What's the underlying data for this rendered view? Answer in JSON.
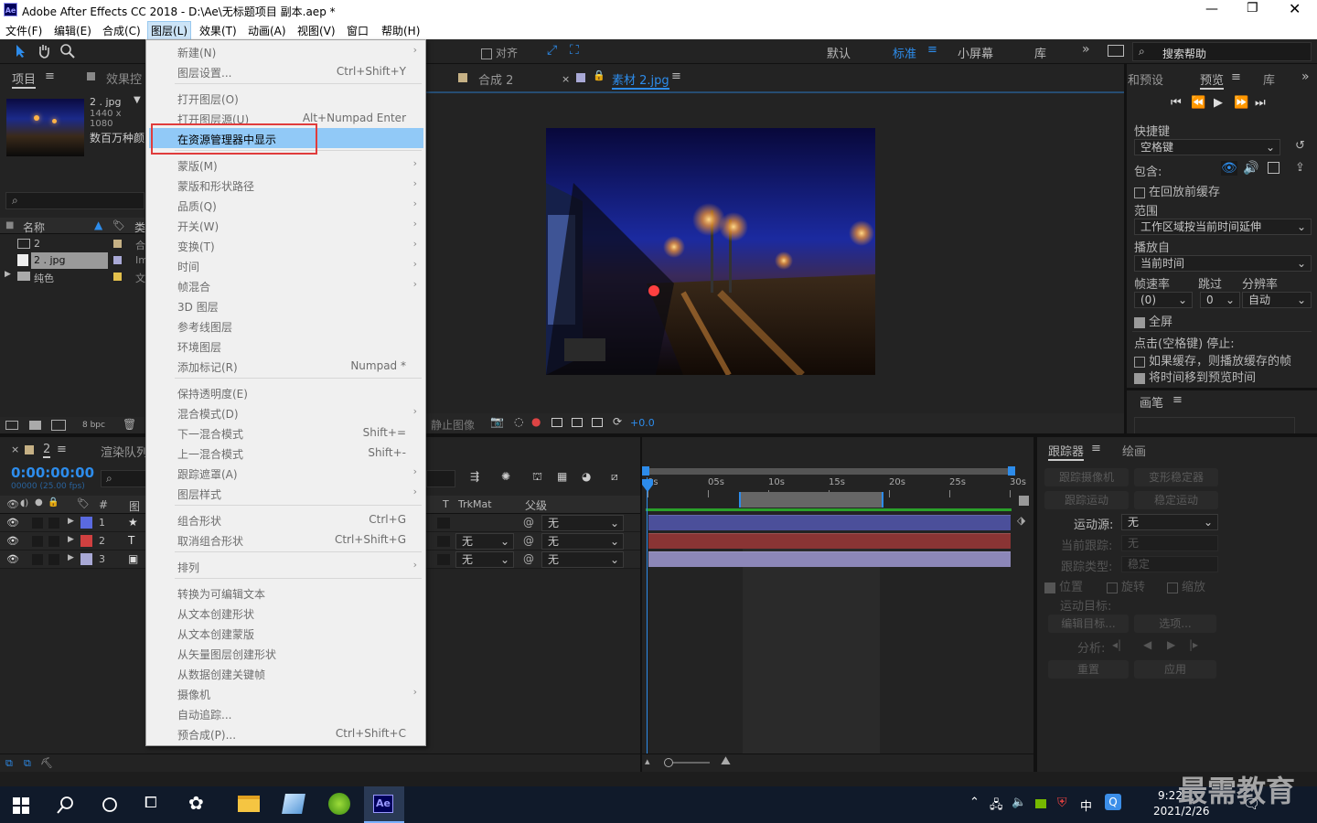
{
  "window": {
    "title": "Adobe After Effects CC 2018 - D:\\Ae\\无标题项目 副本.aep *",
    "logo": "Ae",
    "controls": [
      "minimize-icon",
      "restore-icon",
      "close-icon"
    ]
  },
  "menubar": [
    "文件(F)",
    "编辑(E)",
    "合成(C)",
    "图层(L)",
    "效果(T)",
    "动画(A)",
    "视图(V)",
    "窗口",
    "帮助(H)"
  ],
  "toolbar": {
    "snap": "对齐",
    "workspaces": [
      "默认",
      "标准",
      "小屏幕",
      "库"
    ],
    "search_placeholder": "搜索帮助"
  },
  "project": {
    "tabs": [
      "项目",
      "效果控"
    ],
    "item_name": "2 . jpg",
    "item_size": "1440 x 1080",
    "item_colors": "数百万种颜",
    "col_name": "名称",
    "col_type": "类",
    "rows": [
      {
        "name": "2",
        "tag": "合"
      },
      {
        "name": "2 . jpg",
        "tag": "Im"
      },
      {
        "name": "纯色",
        "tag": "文"
      }
    ],
    "bpc": "8 bpc"
  },
  "comp": {
    "tabs": [
      "合成 2",
      "素材 2.jpg"
    ],
    "footer_label": "静止图像",
    "offset": "+0.0"
  },
  "layer_menu": [
    {
      "label": "新建(N)",
      "submenu": true
    },
    {
      "label": "图层设置...",
      "shortcut": "Ctrl+Shift+Y"
    },
    {
      "sep": true
    },
    {
      "label": "打开图层(O)"
    },
    {
      "label": "打开图层源(U)",
      "shortcut": "Alt+Numpad Enter"
    },
    {
      "label": "在资源管理器中显示",
      "highlight": true
    },
    {
      "sep": true
    },
    {
      "label": "蒙版(M)",
      "submenu": true
    },
    {
      "label": "蒙版和形状路径",
      "submenu": true
    },
    {
      "label": "品质(Q)",
      "submenu": true
    },
    {
      "label": "开关(W)",
      "submenu": true
    },
    {
      "label": "变换(T)",
      "submenu": true
    },
    {
      "label": "时间",
      "submenu": true
    },
    {
      "label": "帧混合",
      "submenu": true
    },
    {
      "label": "3D 图层"
    },
    {
      "label": "参考线图层"
    },
    {
      "label": "环境图层"
    },
    {
      "label": "添加标记(R)",
      "shortcut": "Numpad *"
    },
    {
      "sep": true
    },
    {
      "label": "保持透明度(E)"
    },
    {
      "label": "混合模式(D)",
      "submenu": true
    },
    {
      "label": "下一混合模式",
      "shortcut": "Shift+="
    },
    {
      "label": "上一混合模式",
      "shortcut": "Shift+-"
    },
    {
      "label": "跟踪遮罩(A)",
      "submenu": true
    },
    {
      "label": "图层样式",
      "submenu": true
    },
    {
      "sep": true
    },
    {
      "label": "组合形状",
      "shortcut": "Ctrl+G"
    },
    {
      "label": "取消组合形状",
      "shortcut": "Ctrl+Shift+G"
    },
    {
      "sep": true
    },
    {
      "label": "排列",
      "submenu": true
    },
    {
      "sep": true
    },
    {
      "label": "转换为可编辑文本"
    },
    {
      "label": "从文本创建形状"
    },
    {
      "label": "从文本创建蒙版"
    },
    {
      "label": "从矢量图层创建形状"
    },
    {
      "label": "从数据创建关键帧"
    },
    {
      "label": "摄像机",
      "submenu": true
    },
    {
      "label": "自动追踪..."
    },
    {
      "label": "预合成(P)...",
      "shortcut": "Ctrl+Shift+C"
    }
  ],
  "preview": {
    "tabs": [
      "和预设",
      "预览",
      "库"
    ],
    "shortcut_label": "快捷键",
    "shortcut_value": "空格键",
    "include": "包含:",
    "cache_before": "在回放前缓存",
    "range_label": "范围",
    "range_value": "工作区域按当前时间延伸",
    "play_from_label": "播放自",
    "play_from_value": "当前时间",
    "fps_label": "帧速率",
    "skip_label": "跳过",
    "res_label": "分辨率",
    "fps_value": "(0)",
    "skip_value": "0",
    "res_value": "自动",
    "fullscreen": "全屏",
    "stop_label": "点击(空格键) 停止:",
    "if_cache": "如果缓存，则播放缓存的帧",
    "move_time": "将时间移到预览时间",
    "brush": "画笔"
  },
  "timeline": {
    "comp_tab": "2",
    "render_tab": "渲染队列",
    "timecode": "0:00:00:00",
    "fps": "00000 (25.00 fps)",
    "col_trkmat": "TrkMat",
    "col_parent": "父级",
    "layers": [
      {
        "num": "1",
        "type_icon": "★",
        "color": "#5a6ae0",
        "bar": "#4b4f9a",
        "trk": "",
        "parent": "无"
      },
      {
        "num": "2",
        "type_icon": "T",
        "color": "#d04040",
        "bar": "#8a3434",
        "trk": "无",
        "parent": "无"
      },
      {
        "num": "3",
        "type_icon": "▣",
        "color": "#a9a9d6",
        "bar": "#8c87b8",
        "trk": "无",
        "parent": "无"
      }
    ],
    "ruler": [
      "0s",
      "05s",
      "10s",
      "15s",
      "20s",
      "25s",
      "30s"
    ]
  },
  "tracker": {
    "tabs": [
      "跟踪器",
      "绘画"
    ],
    "buttons": [
      "跟踪摄像机",
      "变形稳定器",
      "跟踪运动",
      "稳定运动"
    ],
    "motion_source": "运动源:",
    "motion_value": "无",
    "current_track": "当前跟踪:",
    "current_value": "无",
    "track_type": "跟踪类型:",
    "track_value": "稳定",
    "opts": [
      "位置",
      "旋转",
      "缩放"
    ],
    "target": "运动目标:",
    "edit_target": "编辑目标...",
    "options": "选项...",
    "analyze": "分析:",
    "reset": "重置",
    "apply": "应用"
  },
  "taskbar": {
    "time": "9:22",
    "date": "2021/2/26",
    "ime": "中",
    "watermark": "最需教育"
  }
}
